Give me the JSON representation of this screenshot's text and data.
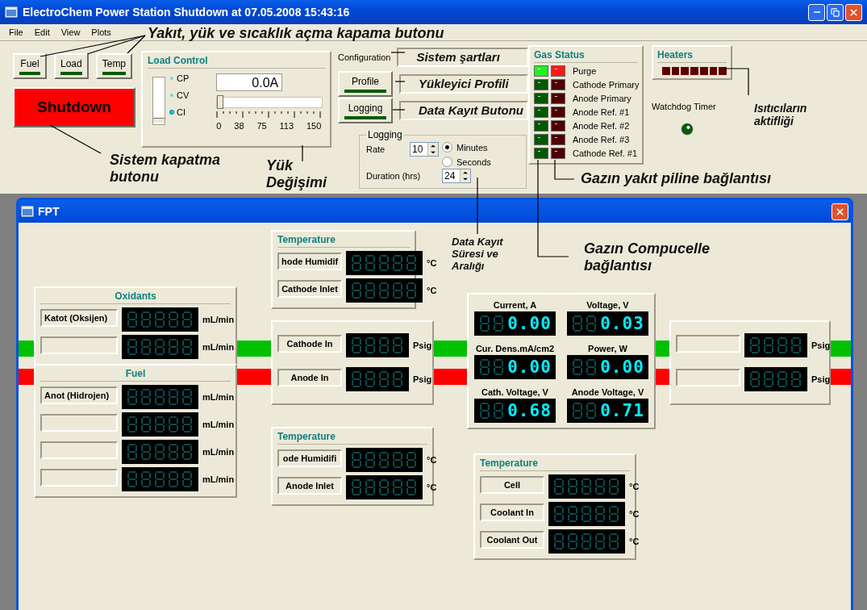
{
  "window": {
    "title": "ElectroChem Power Station Shutdown at 07.05.2008 15:43:16"
  },
  "menu": [
    "File",
    "Edit",
    "View",
    "Plots"
  ],
  "toggles": [
    {
      "label": "Fuel",
      "on": true
    },
    {
      "label": "Load",
      "on": true
    },
    {
      "label": "Temp",
      "on": true
    }
  ],
  "shutdown": {
    "label": "Shutdown"
  },
  "load_control": {
    "title": "Load Control",
    "modes": [
      {
        "label": "CP",
        "selected": false
      },
      {
        "label": "CV",
        "selected": false
      },
      {
        "label": "CI",
        "selected": true
      }
    ],
    "setpoint": "0.0A",
    "level": 0,
    "ticks": [
      "0",
      "38",
      "75",
      "113",
      "150"
    ]
  },
  "configuration": {
    "label": "Configuration"
  },
  "buttons": [
    {
      "label": "Profile",
      "on": true
    },
    {
      "label": "Logging",
      "on": true
    }
  ],
  "logging": {
    "title": "Logging",
    "rate_label": "Rate",
    "rate": "10",
    "units": [
      {
        "label": "Minutes",
        "selected": true
      },
      {
        "label": "Seconds",
        "selected": false
      }
    ],
    "duration_label": "Duration (hrs)",
    "duration": "24"
  },
  "gas_status": {
    "title": "Gas Status",
    "rows": [
      {
        "label": "Purge",
        "compucell_on": true,
        "fuel_cell_on": true
      },
      {
        "label": "Cathode Primary",
        "compucell_on": false,
        "fuel_cell_on": false
      },
      {
        "label": "Anode Primary",
        "compucell_on": false,
        "fuel_cell_on": false
      },
      {
        "label": "Anode Ref. #1",
        "compucell_on": false,
        "fuel_cell_on": false
      },
      {
        "label": "Anode Ref. #2",
        "compucell_on": false,
        "fuel_cell_on": false
      },
      {
        "label": "Anode Ref. #3",
        "compucell_on": false,
        "fuel_cell_on": false
      },
      {
        "label": "Cathode Ref. #1",
        "compucell_on": false,
        "fuel_cell_on": false
      }
    ]
  },
  "heaters": {
    "title": "Heaters",
    "lamps": [
      {
        "on": false
      },
      {
        "on": false
      },
      {
        "on": false
      },
      {
        "on": false
      },
      {
        "on": false
      },
      {
        "on": false
      },
      {
        "on": false
      }
    ]
  },
  "watchdog": {
    "label": "Watchdog Timer",
    "on": false
  },
  "fpt": {
    "title": "FPT",
    "pipes": [
      {
        "color": "#00c000"
      },
      {
        "color": "#ff0000"
      }
    ],
    "panels": [
      {
        "kind": "flow",
        "title": "Oxidants",
        "rows": [
          {
            "label": "Katot (Oksijen)",
            "unit": "mL/min"
          },
          {
            "unit": "mL/min"
          }
        ]
      },
      {
        "kind": "flow",
        "title": "Fuel",
        "rows": [
          {
            "label": "Anot (Hidrojen)",
            "unit": "mL/min"
          },
          {
            "unit": "mL/min"
          },
          {
            "unit": "mL/min"
          },
          {
            "unit": "mL/min"
          }
        ]
      },
      {
        "kind": "temperature",
        "title": "Temperature",
        "rows": [
          {
            "label": "hode Humidif",
            "unit": "°C"
          },
          {
            "label": "Cathode Inlet",
            "unit": "°C"
          }
        ]
      },
      {
        "kind": "pressure",
        "rows": [
          {
            "label": "Cathode In",
            "unit": "Psig"
          },
          {
            "label": "Anode In",
            "unit": "Psig"
          }
        ]
      },
      {
        "kind": "temperature",
        "title": "Temperature",
        "rows": [
          {
            "label": "ode Humidifi",
            "unit": "°C"
          },
          {
            "label": "Anode Inlet",
            "unit": "°C"
          }
        ]
      },
      {
        "kind": "electrical",
        "cells": [
          {
            "label": "Current, A",
            "value": "0.00"
          },
          {
            "label": "Voltage, V",
            "value": "0.03"
          },
          {
            "label": "Cur. Dens.mA/cm2",
            "value": "0.00"
          },
          {
            "label": "Power, W",
            "value": "0.00"
          },
          {
            "label": "Cath. Voltage, V",
            "value": "0.68"
          },
          {
            "label": "Anode Voltage, V",
            "value": "0.71"
          }
        ]
      },
      {
        "kind": "temperature",
        "title": "Temperature",
        "rows": [
          {
            "label": "Cell",
            "unit": "°C"
          },
          {
            "label": "Coolant In",
            "unit": "°C"
          },
          {
            "label": "Coolant Out",
            "unit": "°C"
          }
        ]
      },
      {
        "kind": "pressure",
        "rows": [
          {
            "unit": "Psig"
          },
          {
            "unit": "Psig"
          }
        ]
      }
    ]
  },
  "annotations": [
    "Yakıt, yük ve sıcaklık açma kapama butonu",
    "Sistem kapatma\nbutonu",
    "Yük\nDeğişimi",
    "Sistem şartları",
    "Yükleyici Profili",
    "Data Kayıt Butonu",
    "Isıtıcıların\naktifliği",
    "Gazın yakıt piline bağlantısı",
    "Data Kayıt\nSüresi ve\nAralığı",
    "Gazın Compucelle\nbağlantısı"
  ]
}
